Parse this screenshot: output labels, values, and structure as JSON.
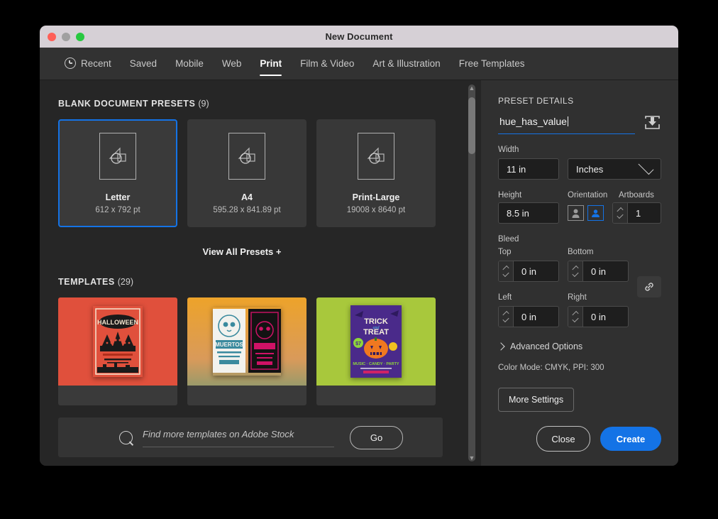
{
  "window": {
    "title": "New Document"
  },
  "tabs": [
    {
      "label": "Recent",
      "icon": "clock-icon",
      "active": false
    },
    {
      "label": "Saved",
      "active": false
    },
    {
      "label": "Mobile",
      "active": false
    },
    {
      "label": "Web",
      "active": false
    },
    {
      "label": "Print",
      "active": true
    },
    {
      "label": "Film & Video",
      "active": false
    },
    {
      "label": "Art & Illustration",
      "active": false
    },
    {
      "label": "Free Templates",
      "active": false
    }
  ],
  "presets_section": {
    "title": "BLANK DOCUMENT PRESETS",
    "count": "(9)",
    "view_all": "View All Presets +",
    "items": [
      {
        "name": "Letter",
        "dimensions": "612 x 792 pt",
        "selected": true
      },
      {
        "name": "A4",
        "dimensions": "595.28 x 841.89 pt",
        "selected": false
      },
      {
        "name": "Print-Large",
        "dimensions": "19008 x 8640 pt",
        "selected": false
      }
    ]
  },
  "templates_section": {
    "title": "TEMPLATES",
    "count": "(29)",
    "items": [
      {
        "name": "Halloween Party Flyer",
        "bg": "#e0503c"
      },
      {
        "name": "Dia de los Muertos Poster",
        "bg": "#eda32a"
      },
      {
        "name": "Trick or Treat Flyer",
        "bg": "#a8c83c"
      }
    ]
  },
  "stock_search": {
    "placeholder": "Find more templates on Adobe Stock",
    "go_label": "Go",
    "icon": "search-icon"
  },
  "preset_details": {
    "title": "PRESET DETAILS",
    "name_value": "hue_has_value",
    "save_icon": "save-preset-icon",
    "width_label": "Width",
    "width_value": "11 in",
    "units_value": "Inches",
    "height_label": "Height",
    "height_value": "8.5 in",
    "orientation_label": "Orientation",
    "orientation_selected": "landscape",
    "artboards_label": "Artboards",
    "artboards_value": "1",
    "bleed_label": "Bleed",
    "bleed_top_label": "Top",
    "bleed_top_value": "0 in",
    "bleed_bottom_label": "Bottom",
    "bleed_bottom_value": "0 in",
    "bleed_left_label": "Left",
    "bleed_left_value": "0 in",
    "bleed_right_label": "Right",
    "bleed_right_value": "0 in",
    "link_icon": "link-icon",
    "advanced_label": "Advanced Options",
    "color_mode_line": "Color Mode:  CMYK,  PPI:  300",
    "more_settings_label": "More Settings"
  },
  "footer_actions": {
    "close_label": "Close",
    "create_label": "Create"
  },
  "colors": {
    "accent": "#1473e6",
    "titlebar": "#d6d0d6",
    "panel_bg": "#262626",
    "right_panel_bg": "#303030"
  }
}
